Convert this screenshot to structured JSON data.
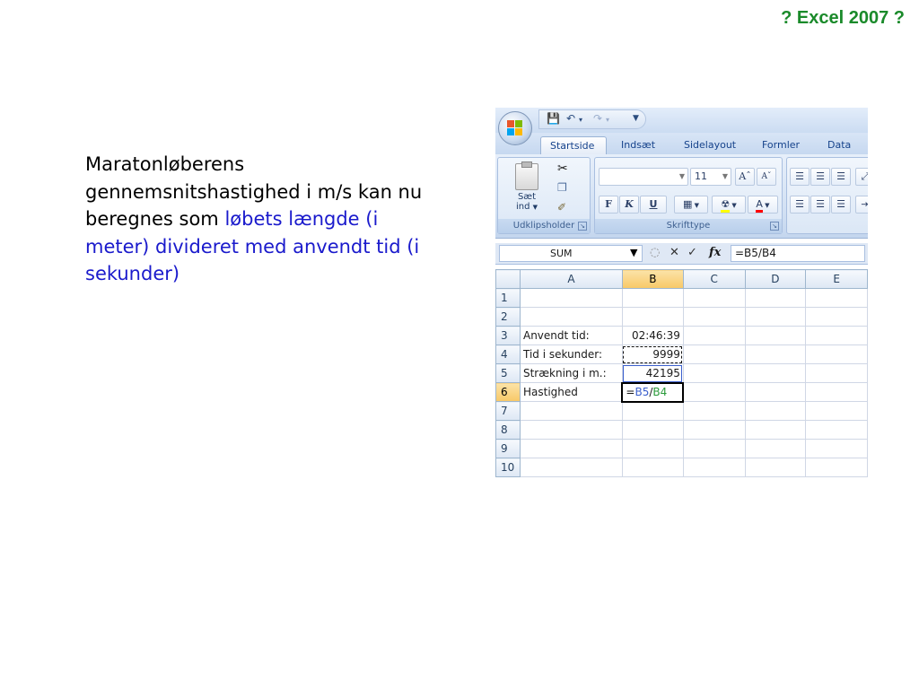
{
  "slide": {
    "title": "? Excel 2007 ?",
    "text_black": "Maratonløberens gennemsnitshastighed i m/s kan nu beregnes som ",
    "text_blue": "løbets længde (i meter) divideret med anvendt tid (i sekunder)"
  },
  "excel": {
    "tabs": [
      "Startside",
      "Indsæt",
      "Sidelayout",
      "Formler",
      "Data"
    ],
    "clipboard": {
      "paste_label_1": "Sæt",
      "paste_label_2": "ind",
      "group_label": "Udklipsholder"
    },
    "font_group": {
      "font_size": "11",
      "group_label": "Skrifttype",
      "bold": "F",
      "italic": "K",
      "underline": "U"
    },
    "name_box": "SUM",
    "formula": "=B5/B4",
    "fx_label": "fx",
    "columns": [
      "A",
      "B",
      "C",
      "D",
      "E"
    ],
    "rows": [
      {
        "num": "1",
        "a": "",
        "b": ""
      },
      {
        "num": "2",
        "a": "",
        "b": ""
      },
      {
        "num": "3",
        "a": "Anvendt tid:",
        "b": "02:46:39"
      },
      {
        "num": "4",
        "a": "Tid i sekunder:",
        "b": "9999"
      },
      {
        "num": "5",
        "a": "Strækning i m.:",
        "b": "42195"
      },
      {
        "num": "6",
        "a": "Hastighed",
        "b": ""
      },
      {
        "num": "7",
        "a": "",
        "b": ""
      },
      {
        "num": "8",
        "a": "",
        "b": ""
      },
      {
        "num": "9",
        "a": "",
        "b": ""
      },
      {
        "num": "10",
        "a": "",
        "b": ""
      }
    ],
    "active_cell_formula": {
      "eq": "=",
      "ref1": "B5",
      "slash": "/",
      "ref2": "B4"
    },
    "colors": {
      "ref1": "#3a5fcd",
      "ref2": "#2a9a3a",
      "title": "#1a8a2a",
      "highlight": "#1a1acc"
    }
  }
}
